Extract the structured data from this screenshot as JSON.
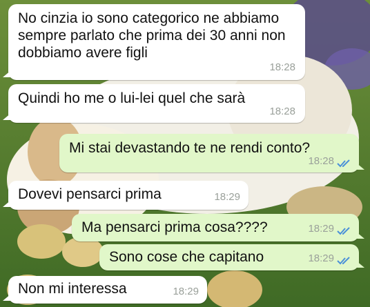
{
  "colors": {
    "incoming_bubble": "#ffffff",
    "outgoing_bubble": "#e1f7c9",
    "timestamp": "#9aa09a",
    "read_ticks": "#4a90d9",
    "grass": "#4f7a2c"
  },
  "messages": [
    {
      "direction": "in",
      "text": "No cinzia io sono categorico ne abbiamo sempre parlato che prima dei 30 anni non dobbiamo avere figli",
      "time": "18:28"
    },
    {
      "direction": "in",
      "text": "Quindi ho me o lui-lei quel che sarà",
      "time": "18:28"
    },
    {
      "direction": "out",
      "text": "Mi stai devastando te ne rendi conto?",
      "time": "18:28",
      "status_icon": "double-check-read-icon"
    },
    {
      "direction": "in",
      "text": "Dovevi pensarci prima",
      "time": "18:29"
    },
    {
      "direction": "out",
      "text": "Ma pensarci prima cosa????",
      "time": "18:29",
      "status_icon": "double-check-read-icon"
    },
    {
      "direction": "out",
      "text": "Sono cose che capitano",
      "time": "18:29",
      "status_icon": "double-check-read-icon"
    },
    {
      "direction": "in",
      "text": "Non mi interessa",
      "time": "18:29"
    }
  ]
}
